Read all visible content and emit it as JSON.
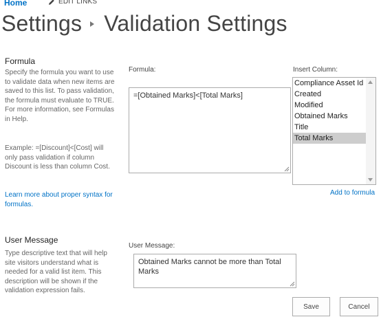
{
  "nav": {
    "home": "Home",
    "edit_links": "EDIT LINKS"
  },
  "title": {
    "parent": "Settings",
    "current": "Validation Settings"
  },
  "formula_section": {
    "heading": "Formula",
    "description": "Specify the formula you want to use to validate data when new items are saved to this list. To pass validation, the formula must evaluate to TRUE. For more information, see Formulas in Help.",
    "example": "Example: =[Discount]<[Cost] will only pass validation if column Discount is less than column Cost.",
    "learn_more": "Learn more about proper syntax for formulas.",
    "formula_label": "Formula:",
    "formula_value": "=[Obtained Marks]<[Total Marks]",
    "insert_column_label": "Insert Column:",
    "columns": [
      "Compliance Asset Id",
      "Created",
      "Modified",
      "Obtained Marks",
      "Title",
      "Total Marks"
    ],
    "selected_column": "Total Marks",
    "add_to_formula": "Add to formula"
  },
  "message_section": {
    "heading": "User Message",
    "description": "Type descriptive text that will help site visitors understand what is needed for a valid list item. This description will be shown if the validation expression fails.",
    "message_label": "User Message:",
    "message_value": "Obtained Marks cannot be more than Total Marks"
  },
  "buttons": {
    "save": "Save",
    "cancel": "Cancel"
  },
  "icons": {
    "edit_links": "pencil-icon",
    "breadcrumb_separator": "triangle-right-icon"
  },
  "colors": {
    "link": "#0072c6",
    "text": "#444444",
    "selection": "#cdcdcd"
  }
}
